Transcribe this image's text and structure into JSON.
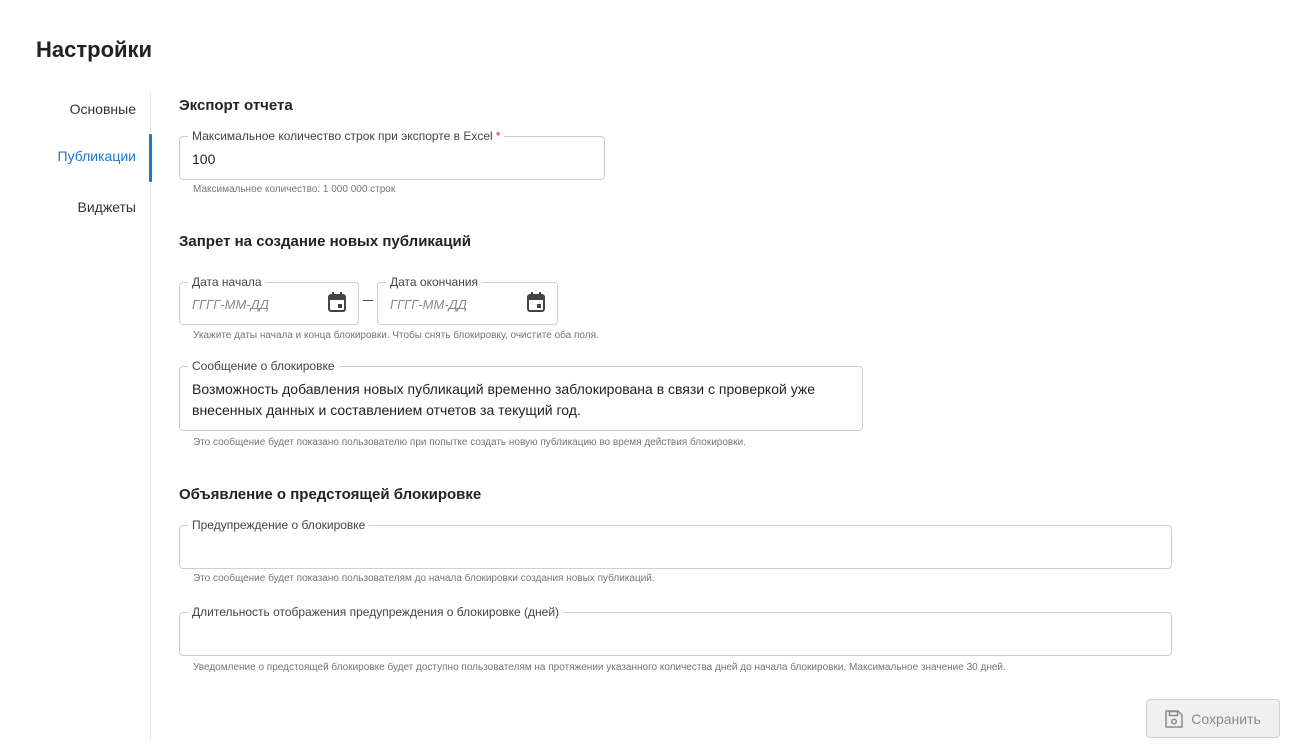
{
  "page": {
    "title": "Настройки"
  },
  "sidebar": {
    "items": [
      {
        "label": "Основные",
        "active": false
      },
      {
        "label": "Публикации",
        "active": true
      },
      {
        "label": "Виджеты",
        "active": false
      }
    ]
  },
  "export_section": {
    "title": "Экспорт отчета",
    "max_rows": {
      "label": "Максимальное количество строк при экспорте в Excel",
      "required_mark": "*",
      "value": "100",
      "helper": "Максимальное количество: 1 000 000 строк"
    }
  },
  "ban_section": {
    "title": "Запрет на создание новых публикаций",
    "start_date": {
      "label": "Дата начала",
      "placeholder": "ГГГГ-ММ-ДД"
    },
    "end_date": {
      "label": "Дата окончания",
      "placeholder": "ГГГГ-ММ-ДД"
    },
    "dates_helper": "Укажите даты начала и конца блокировки. Чтобы снять блокировку, очистите оба поля.",
    "message": {
      "label": "Сообщение о блокировке",
      "value": "Возможность добавления новых публикаций временно заблокирована в связи с проверкой уже внесенных данных и составлением отчетов за текущий год.",
      "helper": "Это сообщение будет показано пользователю при попытке создать новую публикацию во время действия блокировки."
    }
  },
  "announce_section": {
    "title": "Объявление о предстоящей блокировке",
    "warning": {
      "label": "Предупреждение о блокировке",
      "value": "",
      "helper": "Это сообщение будет показано пользователям до начала блокировки создания новых публикаций."
    },
    "duration": {
      "label": "Длительность отображения предупреждения о блокировке (дней)",
      "value": "",
      "helper": "Уведомление о предстоящей блокировке будет доступно пользователям на протяжении указанного количества дней до начала блокировки. Максимальное значение 30 дней."
    }
  },
  "actions": {
    "save_label": "Сохранить"
  },
  "colors": {
    "accent": "#1976d2",
    "required": "#d32f2f",
    "border": "#cfcfcf"
  },
  "icons": {
    "date_picker": "calendar-icon",
    "save": "floppy-disk-icon"
  }
}
